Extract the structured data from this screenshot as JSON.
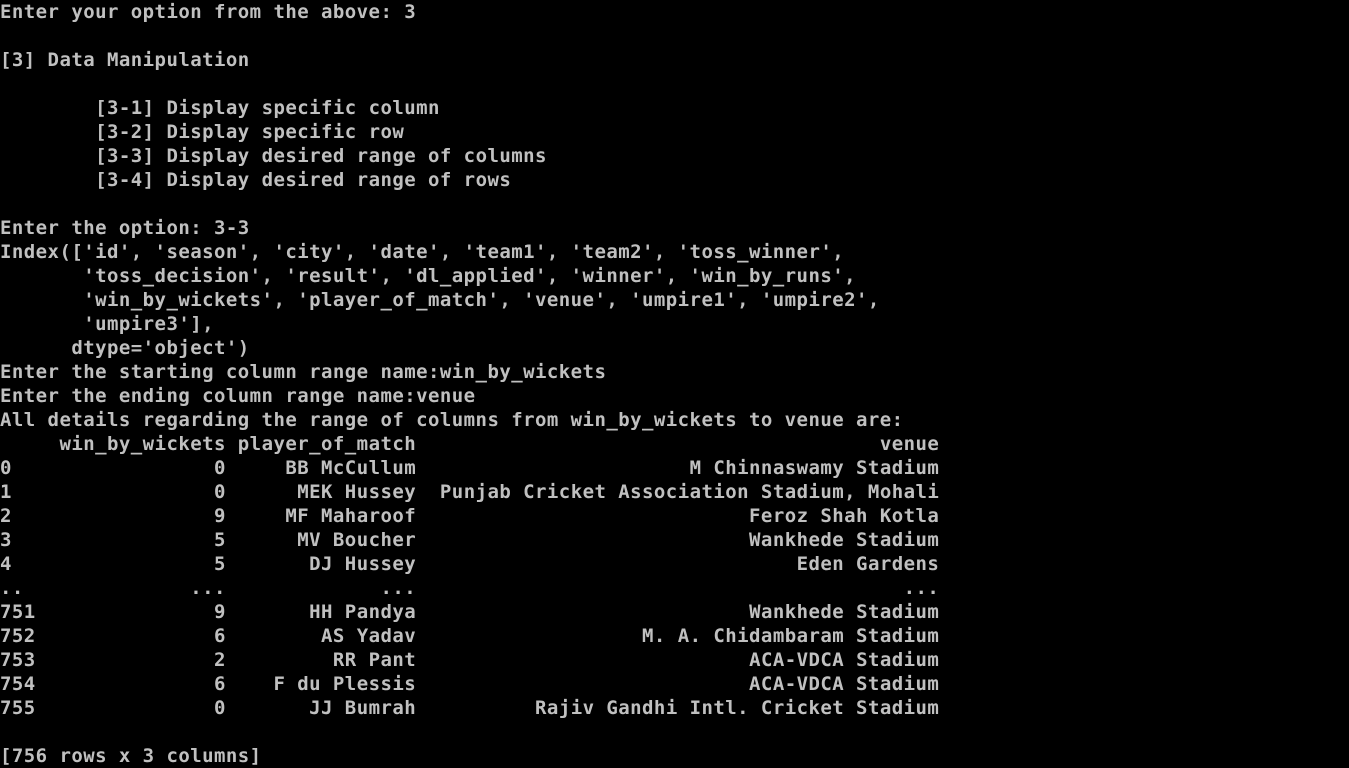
{
  "theme": {
    "background": "#000000",
    "text": "#c0c0c0"
  },
  "console": {
    "prompt_main": "Enter your option from the above: 3",
    "section_title": "[3] Data Manipulation",
    "menu_items": [
      "[3-1] Display specific column",
      "[3-2] Display specific row",
      "[3-3] Display desired range of columns",
      "[3-4] Display desired range of rows"
    ],
    "prompt_option": "Enter the option: 3-3",
    "index_output": [
      "Index(['id', 'season', 'city', 'date', 'team1', 'team2', 'toss_winner',",
      "       'toss_decision', 'result', 'dl_applied', 'winner', 'win_by_runs',",
      "       'win_by_wickets', 'player_of_match', 'venue', 'umpire1', 'umpire2',",
      "       'umpire3'],",
      "      dtype='object')"
    ],
    "prompt_start": "Enter the starting column range name:win_by_wickets",
    "prompt_end": "Enter the ending column range name:venue",
    "result_heading": "All details regarding the range of columns from win_by_wickets to venue are:",
    "table_columns": [
      "win_by_wickets",
      "player_of_match",
      "venue"
    ],
    "table_rows": [
      {
        "index": "0",
        "win_by_wickets": "0",
        "player_of_match": "BB McCullum",
        "venue": "M Chinnaswamy Stadium"
      },
      {
        "index": "1",
        "win_by_wickets": "0",
        "player_of_match": "MEK Hussey",
        "venue": "Punjab Cricket Association Stadium, Mohali"
      },
      {
        "index": "2",
        "win_by_wickets": "9",
        "player_of_match": "MF Maharoof",
        "venue": "Feroz Shah Kotla"
      },
      {
        "index": "3",
        "win_by_wickets": "5",
        "player_of_match": "MV Boucher",
        "venue": "Wankhede Stadium"
      },
      {
        "index": "4",
        "win_by_wickets": "5",
        "player_of_match": "DJ Hussey",
        "venue": "Eden Gardens"
      },
      {
        "index": "..",
        "win_by_wickets": "...",
        "player_of_match": "...",
        "venue": "..."
      },
      {
        "index": "751",
        "win_by_wickets": "9",
        "player_of_match": "HH Pandya",
        "venue": "Wankhede Stadium"
      },
      {
        "index": "752",
        "win_by_wickets": "6",
        "player_of_match": "AS Yadav",
        "venue": "M. A. Chidambaram Stadium"
      },
      {
        "index": "753",
        "win_by_wickets": "2",
        "player_of_match": "RR Pant",
        "venue": "ACA-VDCA Stadium"
      },
      {
        "index": "754",
        "win_by_wickets": "6",
        "player_of_match": "F du Plessis",
        "venue": "ACA-VDCA Stadium"
      },
      {
        "index": "755",
        "win_by_wickets": "0",
        "player_of_match": "JJ Bumrah",
        "venue": "Rajiv Gandhi Intl. Cricket Stadium"
      }
    ],
    "table_summary": "[756 rows x 3 columns]"
  }
}
